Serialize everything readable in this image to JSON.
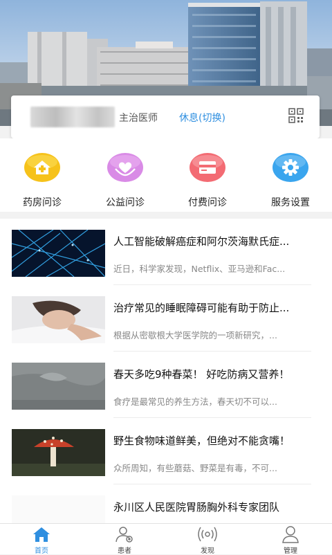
{
  "doctor": {
    "title": "主治医师",
    "status": "休息(切换)"
  },
  "menu": [
    {
      "label": "药房问诊",
      "icon": "pharmacy-house-icon",
      "color": "#f6c21a"
    },
    {
      "label": "公益问诊",
      "icon": "heart-hands-icon",
      "color": "#d98be6"
    },
    {
      "label": "付费问诊",
      "icon": "card-icon",
      "color": "#f36b73"
    },
    {
      "label": "服务设置",
      "icon": "gear-icon",
      "color": "#3aa5ee"
    }
  ],
  "news": [
    {
      "title": "人工智能破解癌症和阿尔茨海默氏症...",
      "summary": "近日，科学家发现，Netflix、亚马逊和Fac..."
    },
    {
      "title": "治疗常见的睡眠障碍可能有助于防止...",
      "summary": "根据从密歇根大学医学院的一项新研究，..."
    },
    {
      "title": "春天多吃9种春菜！ 好吃防病又营养！",
      "summary": "食疗是最常见的养生方法，春天切不可以..."
    },
    {
      "title": "野生食物味道鲜美，但绝对不能贪嘴！",
      "summary": "众所周知，有些蘑菇、野菜是有毒，不可..."
    },
    {
      "title": "永川区人民医院胃肠胸外科专家团队",
      "summary": ""
    }
  ],
  "tabs": [
    {
      "label": "首页",
      "icon": "home-icon",
      "active": true
    },
    {
      "label": "患者",
      "icon": "patients-icon",
      "active": false
    },
    {
      "label": "发现",
      "icon": "discover-icon",
      "active": false
    },
    {
      "label": "管理",
      "icon": "profile-icon",
      "active": false
    }
  ],
  "colors": {
    "accent": "#2f8fe0"
  }
}
